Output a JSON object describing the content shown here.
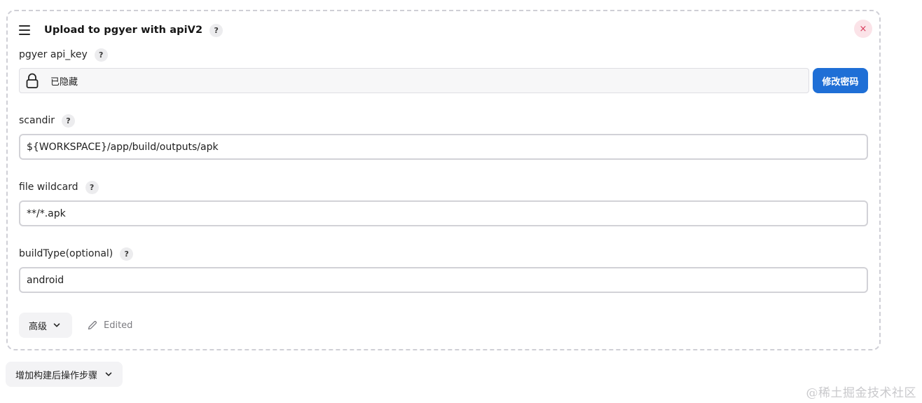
{
  "step": {
    "title": "Upload to pgyer with apiV2",
    "help_label": "?",
    "close_label": "×"
  },
  "fields": {
    "api_key": {
      "label": "pgyer api_key",
      "help_label": "?",
      "value": "已隐藏",
      "change_button_label": "修改密码"
    },
    "scandir": {
      "label": "scandir",
      "help_label": "?",
      "value": "${WORKSPACE}/app/build/outputs/apk"
    },
    "file_wildcard": {
      "label": "file wildcard",
      "help_label": "?",
      "value": "**/*.apk"
    },
    "build_type": {
      "label": "buildType(optional)",
      "help_label": "?",
      "value": "android"
    }
  },
  "footer": {
    "advanced_label": "高级",
    "edited_label": "Edited"
  },
  "add_post_build_step_label": "增加构建后操作步骤",
  "watermark": "@稀土掘金技术社区",
  "icons": {
    "drag": "drag-handle-icon",
    "lock": "lock-icon",
    "chevron": "chevron-down-icon",
    "pencil": "pencil-icon"
  },
  "colors": {
    "primary_button": "#1f6fd6",
    "close_bg": "#fbe3e8",
    "close_fg": "#d83a5b",
    "dashed_border": "#cfcfd6"
  }
}
